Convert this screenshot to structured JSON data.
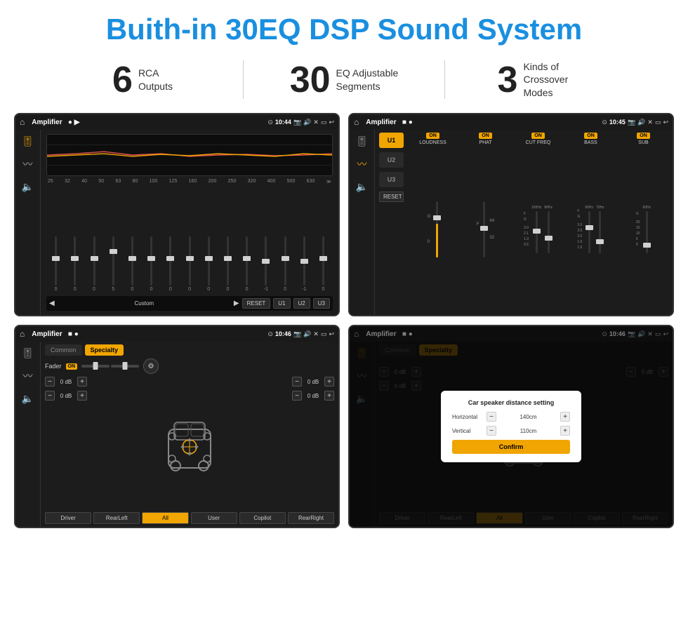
{
  "header": {
    "title": "Buith-in 30EQ DSP Sound System"
  },
  "stats": [
    {
      "number": "6",
      "label": "RCA\nOutputs"
    },
    {
      "number": "30",
      "label": "EQ Adjustable\nSegments"
    },
    {
      "number": "3",
      "label": "Kinds of\nCrossover Modes"
    }
  ],
  "screens": [
    {
      "id": "eq-screen",
      "statusBar": {
        "title": "Amplifier",
        "time": "10:44"
      },
      "type": "eq"
    },
    {
      "id": "crossover-screen",
      "statusBar": {
        "title": "Amplifier",
        "time": "10:45"
      },
      "type": "crossover"
    },
    {
      "id": "fader-screen",
      "statusBar": {
        "title": "Amplifier",
        "time": "10:46"
      },
      "type": "fader"
    },
    {
      "id": "distance-screen",
      "statusBar": {
        "title": "Amplifier",
        "time": "10:46"
      },
      "type": "distance"
    }
  ],
  "eq": {
    "frequencies": [
      "25",
      "32",
      "40",
      "50",
      "63",
      "80",
      "100",
      "125",
      "160",
      "200",
      "250",
      "320",
      "400",
      "500",
      "630"
    ],
    "values": [
      "0",
      "0",
      "0",
      "5",
      "0",
      "0",
      "0",
      "0",
      "0",
      "0",
      "0",
      "-1",
      "0",
      "-1",
      ""
    ],
    "presets": [
      "Custom",
      "RESET",
      "U1",
      "U2",
      "U3"
    ],
    "thumbPositions": [
      50,
      50,
      50,
      35,
      50,
      50,
      50,
      50,
      50,
      50,
      50,
      55,
      50,
      55,
      50
    ]
  },
  "crossover": {
    "presets": [
      "U1",
      "U2",
      "U3"
    ],
    "columns": [
      {
        "name": "LOUDNESS",
        "on": true
      },
      {
        "name": "PHAT",
        "on": true
      },
      {
        "name": "CUT FREQ",
        "on": true
      },
      {
        "name": "BASS",
        "on": true
      },
      {
        "name": "SUB",
        "on": true
      }
    ],
    "resetLabel": "RESET"
  },
  "fader": {
    "tabs": [
      "Common",
      "Specialty"
    ],
    "activeTab": 1,
    "faderLabel": "Fader",
    "onBadge": "ON",
    "dbValues": [
      "0 dB",
      "0 dB",
      "0 dB",
      "0 dB"
    ],
    "bottomBtns": [
      "Driver",
      "RearLeft",
      "All",
      "User",
      "Copilot",
      "RearRight"
    ]
  },
  "distance": {
    "tabs": [
      "Common",
      "Specialty"
    ],
    "dialog": {
      "title": "Car speaker distance setting",
      "rows": [
        {
          "label": "Horizontal",
          "value": "140cm"
        },
        {
          "label": "Vertical",
          "value": "110cm"
        }
      ],
      "confirmLabel": "Confirm"
    },
    "dbValues": [
      "0 dB",
      "0 dB"
    ],
    "bottomBtns": [
      "Driver",
      "RearLeft",
      "All",
      "User",
      "Copilot",
      "RearRight"
    ]
  },
  "colors": {
    "accent": "#f0a500",
    "brand": "#1a8fe0",
    "bg": "#1c1c1c",
    "statusBg": "#1a1a1a"
  }
}
